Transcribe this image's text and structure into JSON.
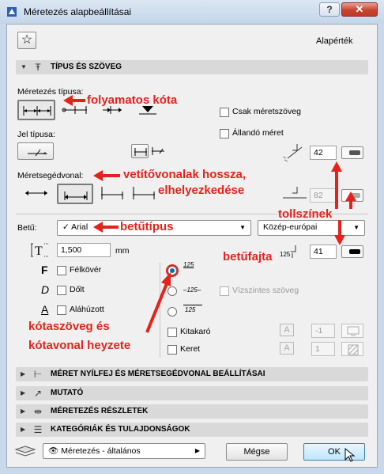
{
  "window": {
    "title": "Méretezés alapbeállításai",
    "help_label": "?",
    "close_label": "✕"
  },
  "favorites_label": "☆",
  "defaults_label": "Alapérték",
  "sections": {
    "type_text": "TÍPUS ÉS SZÖVEG",
    "arrowhead": "MÉRET NYÍLFEJ ÉS MÉRETSEGÉDVONAL BEÁLLÍTÁSAI",
    "marker": "MUTATÓ",
    "details": "MÉRETEZÉS RÉSZLETEK",
    "categories": "KATEGÓRIÁK ÉS TULAJDONSÁGOK"
  },
  "dim_type_label": "Méretezés típusa:",
  "text_only_label": "Csak méretszöveg",
  "marker_type_label": "Jel típusa:",
  "fixed_dim_label": "Állandó méret",
  "witness_label": "Méretsegédvonal:",
  "pen1_value": "42",
  "pen2_value": "82",
  "font": {
    "label": "Betű:",
    "value": "Arial",
    "check": "✓",
    "encoding": "Közép-európai",
    "size_value": "1,500",
    "size_unit": "mm",
    "pen_value": "41"
  },
  "style": {
    "bold": "Félkövér",
    "italic": "Dőlt",
    "underline": "Aláhúzott"
  },
  "style_letters": {
    "bold": "F",
    "italic": "D",
    "underline": "A"
  },
  "text_pos": {
    "sample": "125",
    "horizontal_label": "Vízszintes szöveg"
  },
  "fill": {
    "label": "Kitakaró",
    "value": "-1"
  },
  "frame": {
    "label": "Keret",
    "value": "1"
  },
  "footer": {
    "view_label": "Méretezés - általános",
    "cancel_label": "Mégse",
    "ok_label": "OK"
  },
  "annotations": {
    "continuous": "folyamatos kóta",
    "witness": "vetítővonalak hossza,",
    "witness2": "elhelyezkedése",
    "pen_colors": "tollszínek",
    "font_type": "betűtípus",
    "font_kind": "betűfajta",
    "text_position": "kótaszöveg és",
    "text_position2": "kótavonal heyzete"
  }
}
